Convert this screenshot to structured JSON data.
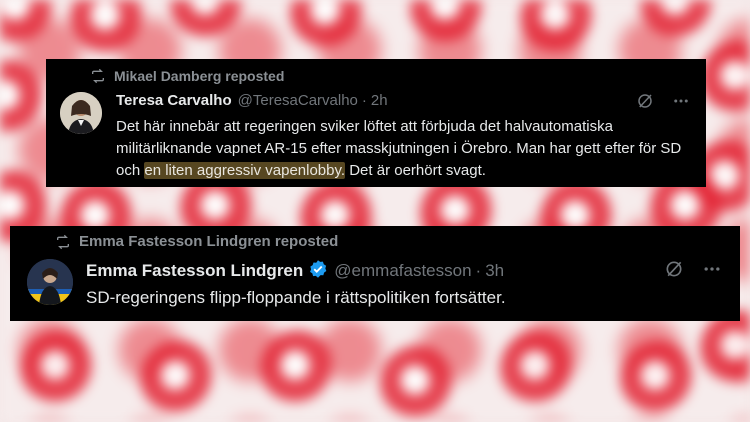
{
  "posts": [
    {
      "repost_label": "Mikael Damberg reposted",
      "author_name": "Teresa Carvalho",
      "handle": "@TeresaCarvalho",
      "separator": "·",
      "time": "2h",
      "text_before": "Det här innebär att regeringen sviker löftet att förbjuda det halvautomatiska militärliknande vapnet AR-15 efter masskjutningen i Örebro. Man har gett efter för SD och ",
      "text_highlight": "en liten aggressiv vapenlobby.",
      "text_after": " Det är oerhört svagt.",
      "verified": false
    },
    {
      "repost_label": "Emma Fastesson Lindgren reposted",
      "author_name": "Emma Fastesson Lindgren",
      "handle": "@emmafastesson",
      "separator": "·",
      "time": "3h",
      "text": "SD-regeringens flipp-floppande i rättspolitiken fortsätter.",
      "verified": true
    }
  ],
  "colors": {
    "card_bg": "#000000",
    "text": "#e7e9ea",
    "muted": "#71767b",
    "verified_blue": "#1d9bf0",
    "highlight": "#9e823c",
    "background_rose": "#e32636"
  },
  "icons": [
    "repost-icon",
    "grok-icon",
    "more-icon",
    "verified-badge-icon"
  ]
}
